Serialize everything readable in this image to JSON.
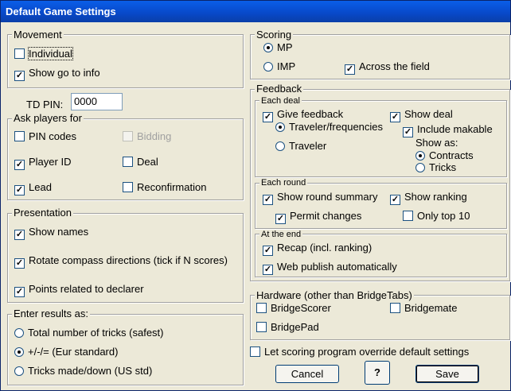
{
  "window": {
    "title": "Default Game Settings"
  },
  "movement": {
    "label": "Movement",
    "individual": "Individual",
    "show_go_to_info": "Show go to info"
  },
  "td_pin": {
    "label": "TD PIN:",
    "value": "0000"
  },
  "ask_players": {
    "label": "Ask players for",
    "pin_codes": "PIN codes",
    "bidding": "Bidding",
    "player_id": "Player ID",
    "deal": "Deal",
    "lead": "Lead",
    "reconfirmation": "Reconfirmation"
  },
  "presentation": {
    "label": "Presentation",
    "show_names": "Show names",
    "rotate_compass": "Rotate compass directions (tick if N scores)",
    "points_related": "Points related to declarer"
  },
  "enter_results": {
    "label": "Enter results as:",
    "total_tricks": "Total number of tricks (safest)",
    "plus_minus": "+/-/= (Eur standard)",
    "tricks_made": "Tricks made/down (US std)"
  },
  "scoring": {
    "label": "Scoring",
    "mp": "MP",
    "imp": "IMP",
    "across_field": "Across the field"
  },
  "feedback": {
    "label": "Feedback",
    "each_deal": {
      "label": "Each deal",
      "give_feedback": "Give feedback",
      "traveler_freq": "Traveler/frequencies",
      "traveler": "Traveler",
      "show_deal": "Show deal",
      "include_makable": "Include makable",
      "show_as": "Show as:",
      "contracts": "Contracts",
      "tricks": "Tricks"
    },
    "each_round": {
      "label": "Each round",
      "show_round_summary": "Show round summary",
      "show_ranking": "Show ranking",
      "permit_changes": "Permit changes",
      "only_top_10": "Only top 10"
    },
    "at_the_end": {
      "label": "At the end",
      "recap": "Recap (incl. ranking)",
      "web_publish": "Web publish automatically"
    }
  },
  "hardware": {
    "label": "Hardware (other than BridgeTabs)",
    "bridgescorer": "BridgeScorer",
    "bridgemate": "Bridgemate",
    "bridgepad": "BridgePad"
  },
  "override": {
    "label": "Let scoring program override default settings"
  },
  "buttons": {
    "cancel": "Cancel",
    "help": "?",
    "save": "Save"
  },
  "colors": {
    "titlebar": "#0a5ee8",
    "face": "#ece9d8",
    "checkbox_border": "#1c5180"
  }
}
